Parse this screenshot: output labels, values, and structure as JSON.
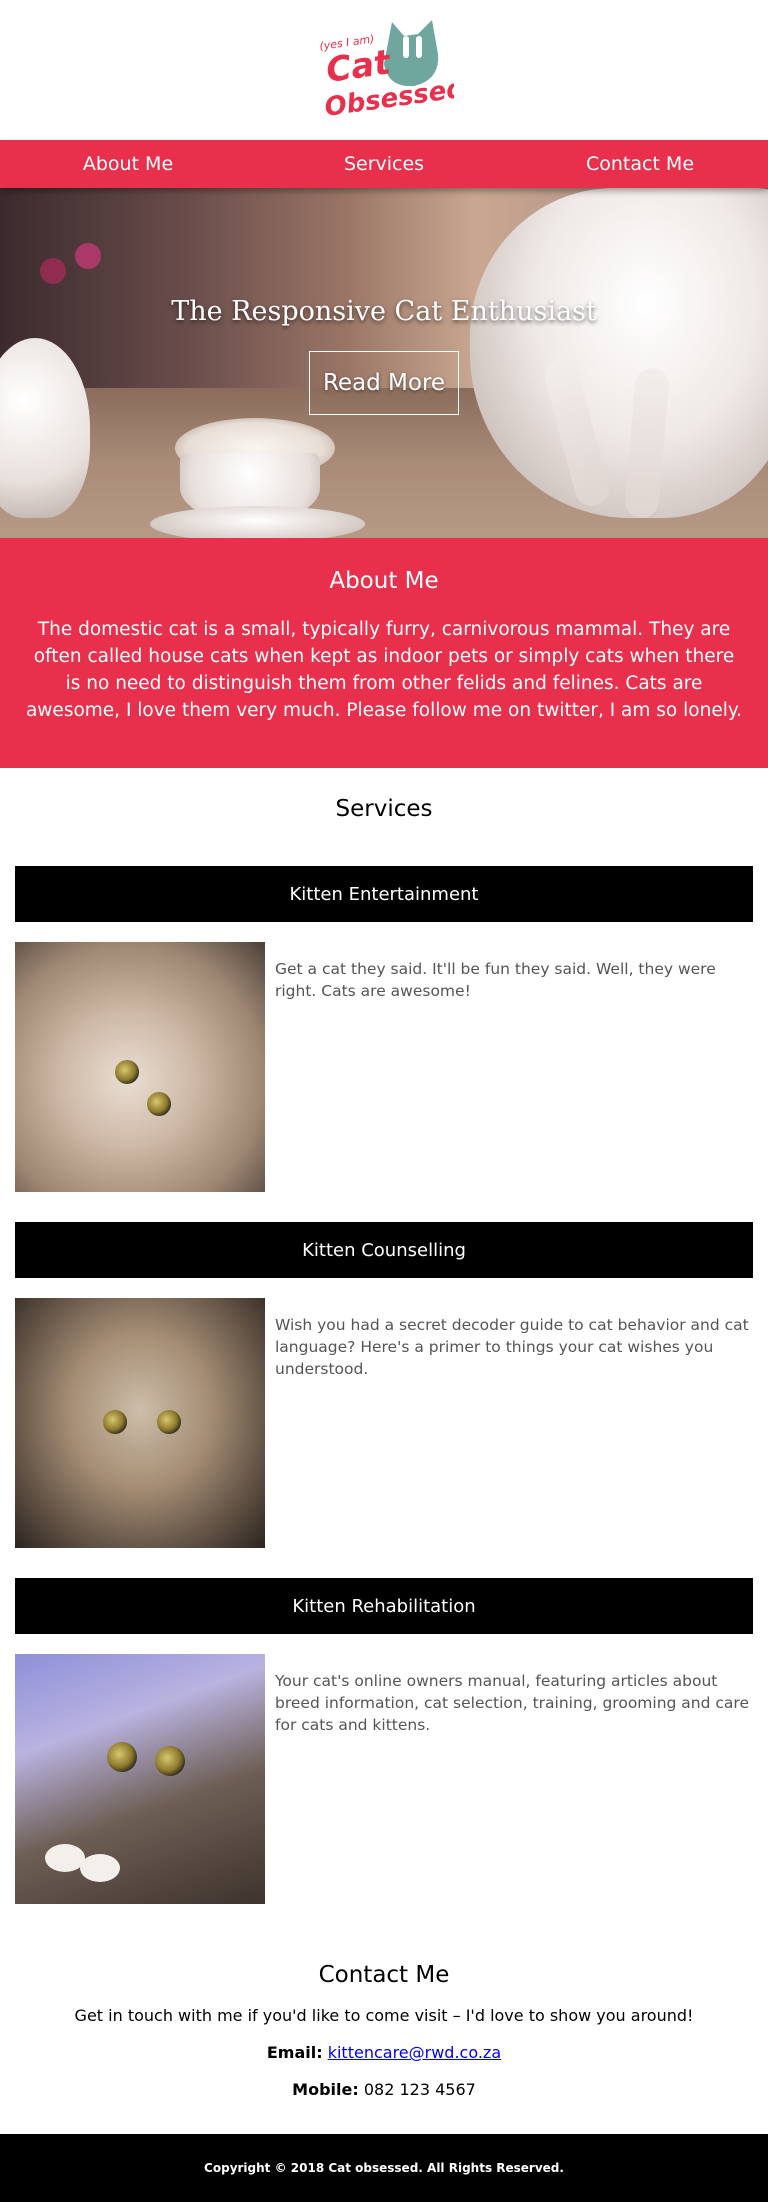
{
  "logo": {
    "line1": "(yes I am)",
    "line2": "Cat",
    "line3": "Obsessed"
  },
  "nav": {
    "items": [
      "About Me",
      "Services",
      "Contact Me"
    ]
  },
  "hero": {
    "title": "The Responsive Cat Enthusiast",
    "button": "Read More"
  },
  "about": {
    "heading": "About Me",
    "text": "The domestic cat is a small, typically furry, carnivorous mammal. They are often called house cats when kept as indoor pets or simply cats when there is no need to distinguish them from other felids and felines. Cats are awesome, I love them very much. Please follow me on twitter, I am so lonely."
  },
  "services": {
    "heading": "Services",
    "items": [
      {
        "title": "Kitten Entertainment",
        "text": "Get a cat they said. It'll be fun they said. Well, they were right. Cats are awesome!"
      },
      {
        "title": "Kitten Counselling",
        "text": "Wish you had a secret decoder guide to cat behavior and cat language? Here's a primer to things your cat wishes you understood."
      },
      {
        "title": "Kitten Rehabilitation",
        "text": "Your cat's online owners manual, featuring articles about breed information, cat selection, training, grooming and care for cats and kittens."
      }
    ]
  },
  "contact": {
    "heading": "Contact Me",
    "intro": "Get in touch with me if you'd like to come visit – I'd love to show you around!",
    "email_label": "Email:",
    "email": "kittencare@rwd.co.za",
    "mobile_label": "Mobile:",
    "mobile": "082 123 4567"
  },
  "footer": {
    "text": "Copyright © 2018 Cat obsessed. All Rights Reserved."
  },
  "colors": {
    "accent": "#e8304d",
    "logo_teal": "#6fa79e",
    "dark": "#000000"
  }
}
